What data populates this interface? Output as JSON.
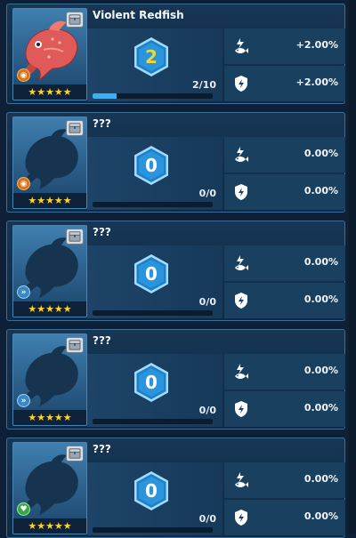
{
  "fish_list": [
    {
      "name": "Violent Redfish",
      "level": "2",
      "level_color": "#e9d93a",
      "progress_text": "2/10",
      "progress_fraction": 0.2,
      "stars": "★★★★★",
      "badge_type": "orange",
      "badge_glyph": "◉",
      "fish_revealed": true,
      "stat1_value": "+2.00%",
      "stat2_value": "+2.00%",
      "stat1_icon": "power-fish-icon",
      "stat2_icon": "shield-lightning-icon"
    },
    {
      "name": "???",
      "level": "0",
      "level_color": "#ffffff",
      "progress_text": "0/0",
      "progress_fraction": 0,
      "stars": "★★★★★",
      "badge_type": "orange",
      "badge_glyph": "◉",
      "fish_revealed": false,
      "stat1_value": "0.00%",
      "stat2_value": "0.00%",
      "stat1_icon": "power-fish-icon",
      "stat2_icon": "shield-lightning-icon"
    },
    {
      "name": "???",
      "level": "0",
      "level_color": "#ffffff",
      "progress_text": "0/0",
      "progress_fraction": 0,
      "stars": "★★★★★",
      "badge_type": "blue",
      "badge_glyph": "»",
      "fish_revealed": false,
      "stat1_value": "0.00%",
      "stat2_value": "0.00%",
      "stat1_icon": "power-fish-icon",
      "stat2_icon": "shield-lightning-icon"
    },
    {
      "name": "???",
      "level": "0",
      "level_color": "#ffffff",
      "progress_text": "0/0",
      "progress_fraction": 0,
      "stars": "★★★★★",
      "badge_type": "blue",
      "badge_glyph": "»",
      "fish_revealed": false,
      "stat1_value": "0.00%",
      "stat2_value": "0.00%",
      "stat1_icon": "power-fish-icon",
      "stat2_icon": "shield-lightning-icon"
    },
    {
      "name": "???",
      "level": "0",
      "level_color": "#ffffff",
      "progress_text": "0/0",
      "progress_fraction": 0,
      "stars": "★★★★★",
      "badge_type": "green",
      "badge_glyph": "♥",
      "fish_revealed": false,
      "stat1_value": "0.00%",
      "stat2_value": "0.00%",
      "stat1_icon": "power-fish-icon",
      "stat2_icon": "shield-lightning-icon"
    }
  ],
  "colors": {
    "accent": "#3db0f1",
    "hex_fill": "#1f7fc7",
    "star": "#ffd22e",
    "card_border": "#3c6f98"
  }
}
